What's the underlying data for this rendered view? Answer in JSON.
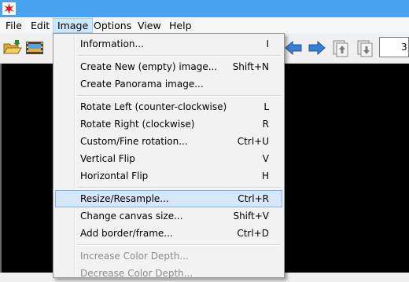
{
  "menubar": {
    "items": [
      "File",
      "Edit",
      "Image",
      "Options",
      "View",
      "Help"
    ],
    "active": "Image"
  },
  "toolbar": {
    "zoom_value": "3,"
  },
  "image_menu": {
    "items": [
      {
        "label": "Information...",
        "accel": "I"
      },
      {
        "label": "Create New (empty) image...",
        "accel": "Shift+N"
      },
      {
        "label": "Create Panorama image...",
        "accel": ""
      },
      {
        "label": "Rotate Left (counter-clockwise)",
        "accel": "L"
      },
      {
        "label": "Rotate Right (clockwise)",
        "accel": "R"
      },
      {
        "label": "Custom/Fine rotation...",
        "accel": "Ctrl+U"
      },
      {
        "label": "Vertical Flip",
        "accel": "V"
      },
      {
        "label": "Horizontal Flip",
        "accel": "H"
      },
      {
        "label": "Resize/Resample...",
        "accel": "Ctrl+R"
      },
      {
        "label": "Change canvas size...",
        "accel": "Shift+V"
      },
      {
        "label": "Add border/frame...",
        "accel": "Ctrl+D"
      },
      {
        "label": "Increase Color Depth...",
        "accel": ""
      },
      {
        "label": "Decrease Color Depth...",
        "accel": ""
      }
    ],
    "highlighted": "Resize/Resample...",
    "disabled": [
      "Increase Color Depth...",
      "Decrease Color Depth..."
    ]
  },
  "colors": {
    "titlebar": "#4aa3f0",
    "menu_highlight": "#d5e8fb",
    "menu_highlight_border": "#7fb4ea",
    "viewer_background": "#000000"
  },
  "icons": [
    "app-logo-icon",
    "open-folder-icon",
    "slideshow-filmstrip-icon",
    "arrow-left-icon",
    "arrow-right-icon",
    "page-up-icon",
    "page-down-icon"
  ]
}
